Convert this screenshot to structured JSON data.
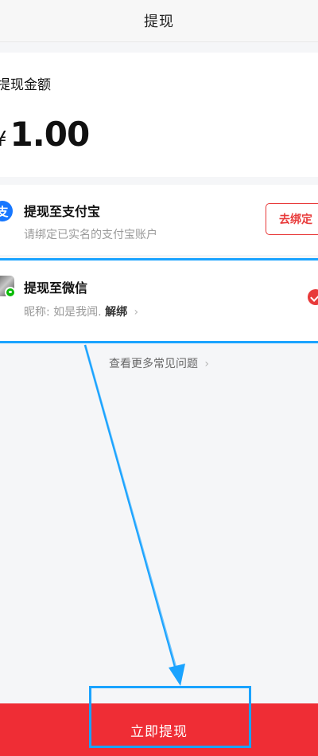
{
  "header": {
    "title": "提现"
  },
  "amount": {
    "label": "提现金额",
    "currency": "¥",
    "value": "1.00"
  },
  "options": {
    "alipay": {
      "icon": "alipay-icon",
      "icon_glyph": "支",
      "title": "提现至支付宝",
      "subtitle": "请绑定已实名的支付宝账户",
      "bind_button": "去绑定"
    },
    "wechat": {
      "icon": "wechat-avatar",
      "title": "提现至微信",
      "nickname_label": "昵称:",
      "nickname": "如是我闻.",
      "unlink": "解绑",
      "chevron": "›",
      "selected": true
    }
  },
  "faq": {
    "label": "查看更多常见问题",
    "chevron": "›"
  },
  "submit": {
    "label": "立即提现"
  },
  "colors": {
    "accent_red": "#ef2d35",
    "alipay_blue": "#1677ff",
    "wechat_green": "#09bb07",
    "annotation_blue": "#1aa3ff"
  }
}
